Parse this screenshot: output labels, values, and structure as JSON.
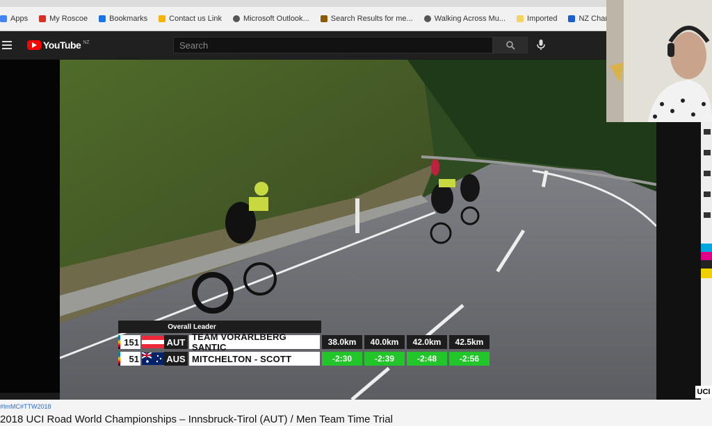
{
  "bookmarks": [
    {
      "label": "Apps",
      "color": "#4285f4"
    },
    {
      "label": "My Roscoe",
      "color": "#d93025"
    },
    {
      "label": "Bookmarks",
      "color": "#1a73e8"
    },
    {
      "label": "Contact us Link",
      "color": "#f4b400"
    },
    {
      "label": "Microsoft Outlook...",
      "color": "#555555"
    },
    {
      "label": "Search Results for me...",
      "color": "#8b5a00"
    },
    {
      "label": "Walking Across Mu...",
      "color": "#555555"
    },
    {
      "label": "Imported",
      "color": "#f4d35e"
    },
    {
      "label": "NZ Chamber Checklist",
      "color": "#1a5fd0"
    }
  ],
  "youtube": {
    "logo": "YouTube",
    "region": "NZ",
    "search_placeholder": "Search",
    "search_icon": "search-icon",
    "mic_icon": "microphone-icon",
    "menu_icon": "hamburger-menu-icon"
  },
  "overlay": {
    "heading": "Overall Leader",
    "distances": [
      "38.0km",
      "40.0km",
      "42.0km",
      "42.5km"
    ],
    "rows": [
      {
        "position": "151",
        "country": "AUT",
        "team": "TEAM VORARLBERG SANTIC",
        "gaps": []
      },
      {
        "position": "51",
        "country": "AUS",
        "team": "MITCHELTON - SCOTT",
        "gaps": [
          "-2:30",
          "-2:39",
          "-2:48",
          "-2:56"
        ]
      }
    ]
  },
  "bottom": {
    "hashtag": "#ImMC#TTW2018",
    "video_title": "2018 UCI Road World Championships – Innsbruck-Tirol (AUT) / Men Team Time Trial",
    "corner_logo": "UCI"
  },
  "colors": {
    "gap_green": "#22c52a",
    "yt_red": "#ff0000",
    "header_dark": "#202020"
  }
}
